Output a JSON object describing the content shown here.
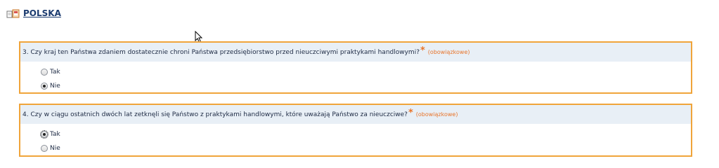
{
  "header": {
    "country_label": "POLSKA",
    "icon": "document-flag-icon"
  },
  "questions": [
    {
      "text": "3. Czy kraj ten Państwa zdaniem dostatecznie chroni Państwa przedsiębiorstwo przed nieuczciwymi praktykami handlowymi?",
      "required_mark": "*",
      "mandatory_label": "(obowiązkowe)",
      "options": [
        {
          "label": "Tak",
          "selected": false
        },
        {
          "label": "Nie",
          "selected": true
        }
      ]
    },
    {
      "text": "4. Czy w ciągu ostatnich dwóch lat zetknęli się Państwo z praktykami handlowymi, które uważają Państwo za nieuczciwe?",
      "required_mark": "*",
      "mandatory_label": "(obowiązkowe)",
      "options": [
        {
          "label": "Tak",
          "selected": true
        },
        {
          "label": "Nie",
          "selected": false
        }
      ]
    }
  ],
  "colors": {
    "border_accent": "#f0a43a",
    "title_bar_bg": "#e8eff6",
    "mandatory_text": "#e8742a",
    "link_text": "#1b3b6f"
  }
}
